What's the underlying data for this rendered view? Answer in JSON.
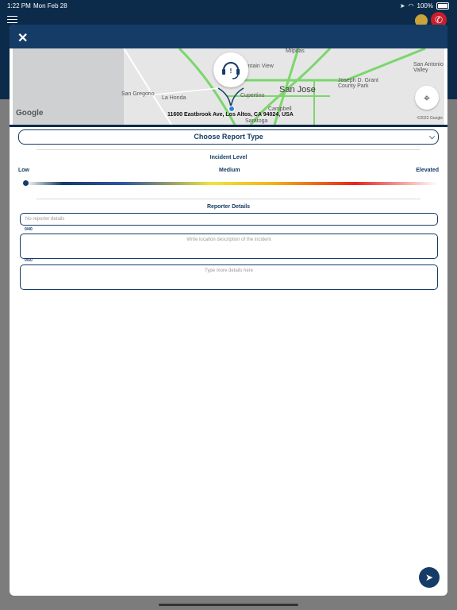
{
  "status": {
    "time": "1:22 PM",
    "date": "Mon Feb 28",
    "battery": "100%"
  },
  "icons": {
    "menu": "hamburger-icon",
    "close": "close-icon",
    "locate": "locate-icon",
    "send": "send-icon",
    "phone": "phone-icon",
    "support": "headset-alert-icon"
  },
  "map": {
    "address": "11600 Eastbrook Ave, Los Altos, CA 94024, USA",
    "labels": [
      "Milpitas",
      "San Jose",
      "San Antonio Valley",
      "Joseph D. Grant County Park",
      "San Gregorio",
      "La Honda",
      "Cupertino",
      "Campbell",
      "Saratoga",
      "Mountain View"
    ],
    "attribution": "Google",
    "copyright": "©2022 Google"
  },
  "form": {
    "report_type_label": "Choose Report Type",
    "incident_level_title": "Incident Level",
    "level_low": "Low",
    "level_medium": "Medium",
    "level_elevated": "Elevated",
    "incident_level_value": 0.0,
    "reporter_title": "Reporter Details",
    "reporter_placeholder": "No reporter details",
    "location_counter": "0/40",
    "location_placeholder": "Write location description of the incident",
    "details_counter": "0/50",
    "details_placeholder": "Type more details here"
  },
  "colors": {
    "primary": "#153c66",
    "app_bg": "#0c2b4a",
    "alert": "#c81e2c"
  }
}
